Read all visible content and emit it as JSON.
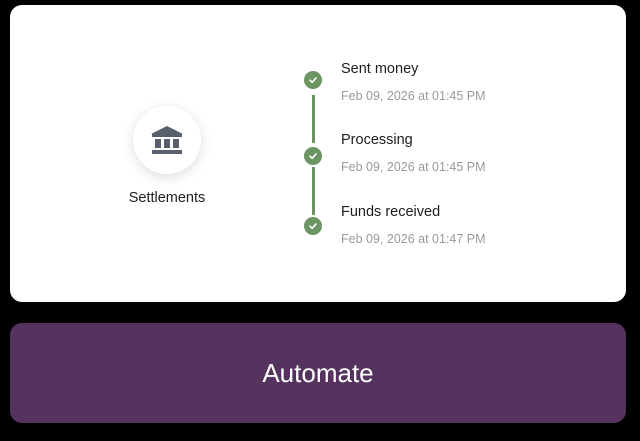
{
  "settlements": {
    "label": "Settlements",
    "icon": "bank-icon"
  },
  "timeline": {
    "accent_color": "#6b9562",
    "steps": [
      {
        "title": "Sent money",
        "time": "Feb 09, 2026 at 01:45 PM",
        "status": "complete"
      },
      {
        "title": "Processing",
        "time": "Feb 09, 2026 at 01:45 PM",
        "status": "complete"
      },
      {
        "title": "Funds received",
        "time": "Feb 09, 2026 at 01:47 PM",
        "status": "complete"
      }
    ]
  },
  "automate_button": {
    "label": "Automate",
    "color": "#56335e"
  }
}
